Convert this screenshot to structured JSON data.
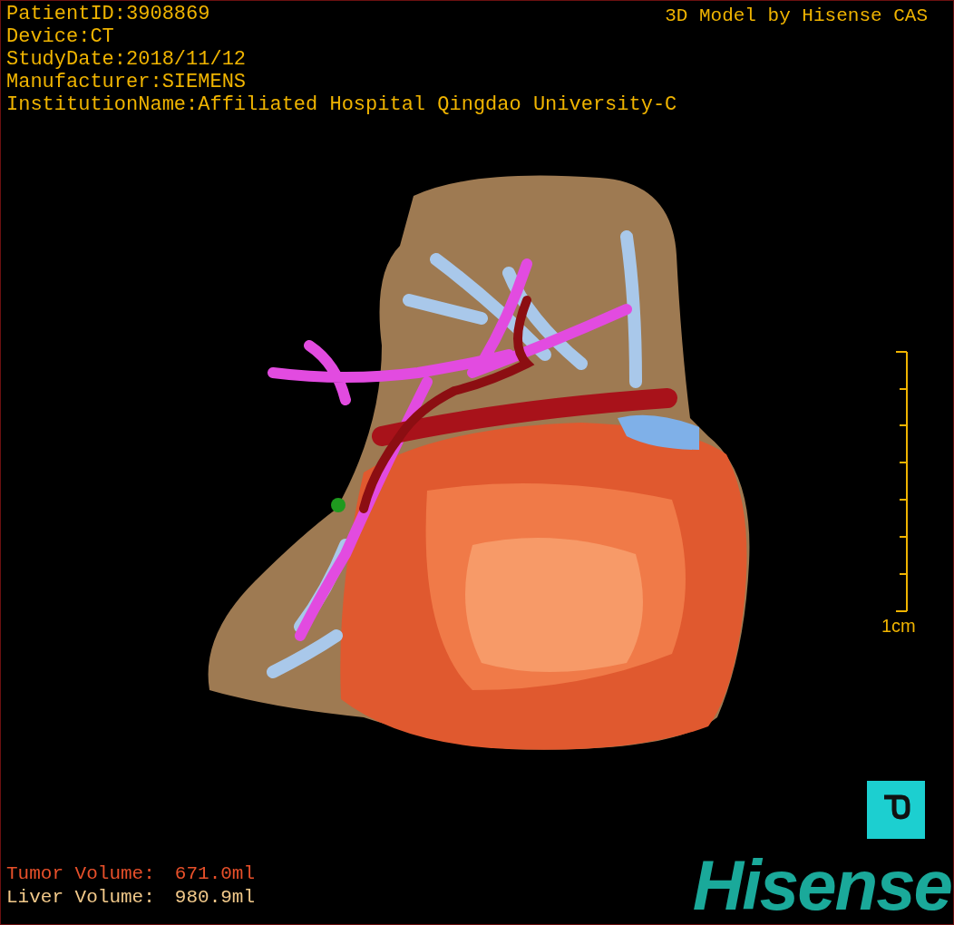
{
  "info_lines": [
    "PatientID:3908869",
    "Device:CT",
    "StudyDate:2018/11/12",
    "Manufacturer:SIEMENS",
    "InstitutionName:Affiliated Hospital Qingdao University-C"
  ],
  "model_credit": "3D Model by Hisense CAS",
  "scale_bar": {
    "label": "1cm"
  },
  "volumes": [
    {
      "kind": "tumor",
      "label": "Tumor Volume:",
      "value": "671.0ml"
    },
    {
      "kind": "liver",
      "label": "Liver Volume:",
      "value": "980.9ml"
    }
  ],
  "logo": {
    "text": "Hisense"
  }
}
